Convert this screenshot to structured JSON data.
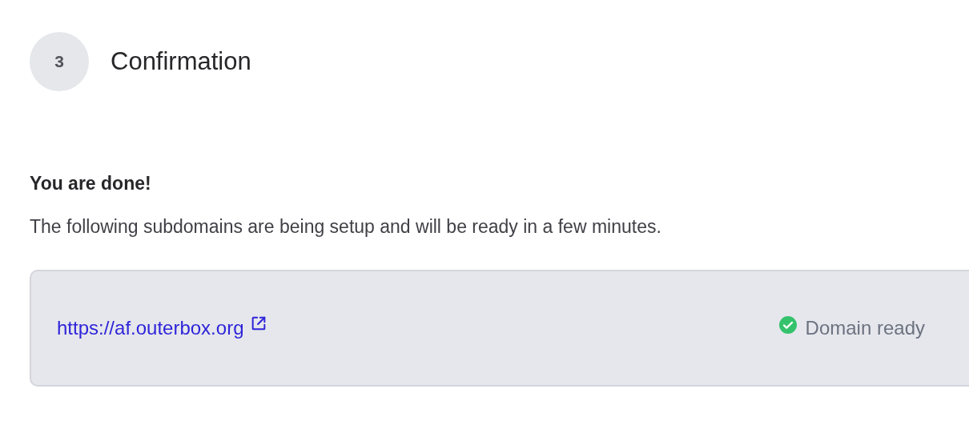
{
  "step": {
    "number": "3",
    "title": "Confirmation"
  },
  "heading": "You are done!",
  "message": "The following subdomains are being setup and will be ready in a few minutes.",
  "subdomains": [
    {
      "url": "https://af.outerbox.org",
      "ready": true,
      "status_label": "Domain ready"
    }
  ]
}
